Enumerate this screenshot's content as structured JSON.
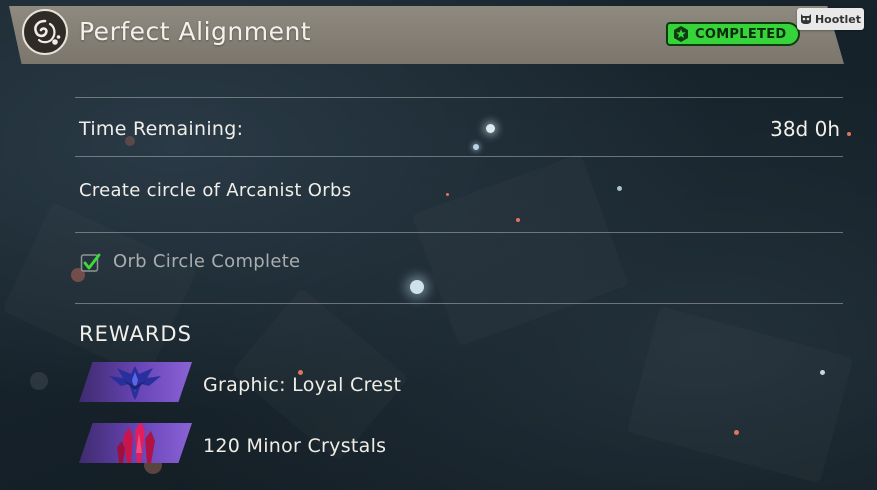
{
  "quest": {
    "title": "Perfect Alignment",
    "status": "COMPLETED",
    "status_color": "#36d43a"
  },
  "extension": {
    "name": "Hootlet"
  },
  "time": {
    "label": "Time Remaining:",
    "value": "38d 0h"
  },
  "description": "Create circle of Arcanist Orbs",
  "objectives": [
    {
      "label": "Orb Circle Complete",
      "done": true,
      "check_color": "#3ddc3a"
    }
  ],
  "rewards": {
    "title": "REWARDS",
    "items": [
      {
        "label": "Graphic: Loyal Crest",
        "icon": "crest-icon"
      },
      {
        "label": "120 Minor Crystals",
        "icon": "crystals-icon"
      }
    ]
  },
  "icons": {
    "emblem": "swirl-emblem-icon",
    "badge": "star-badge-icon",
    "check": "checkmark-icon"
  }
}
